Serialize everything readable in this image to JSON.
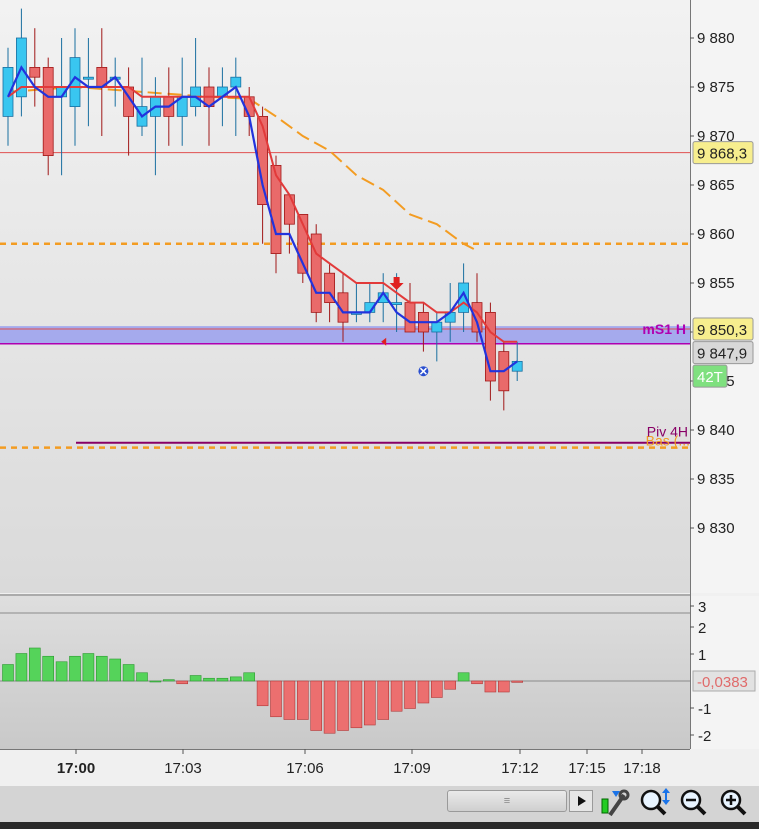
{
  "chart_data": {
    "type": "candlestick",
    "price_axis": {
      "ticks": [
        "9 880",
        "9 875",
        "9 870",
        "9 865",
        "9 860",
        "9 855",
        "9 850",
        "9 845",
        "9 840",
        "9 835",
        "9 830"
      ],
      "tick_values": [
        9880,
        9875,
        9870,
        9865,
        9860,
        9855,
        9850,
        9845,
        9840,
        9835,
        9830
      ],
      "range": [
        9820.8,
        9883
      ]
    },
    "time_axis": {
      "labels": [
        "17:00",
        "17:03",
        "17:06",
        "17:09",
        "17:12",
        "17:15",
        "17:18"
      ]
    },
    "price_tags": [
      {
        "label": "9 868,3",
        "value": 9868.3,
        "bg": "#f7ee8e",
        "color": "#222"
      },
      {
        "label": "9 850,3",
        "value": 9850.3,
        "bg": "#f7ee8e",
        "color": "#222"
      },
      {
        "label": "9 847,9",
        "value": 9847.9,
        "bg": "#d8d8d8",
        "color": "#222"
      },
      {
        "label": "42T",
        "value": 9845.5,
        "bg": "#7fe07f",
        "color": "#ffffff"
      }
    ],
    "levels": [
      {
        "name": "mS1 H",
        "value": 9849.6,
        "color": "#b000b0"
      },
      {
        "name": "Piv 4H",
        "value": 9838.7,
        "color": "#880066"
      },
      {
        "name": "Bas (...",
        "value": 9838.2,
        "color": "#f39c22"
      }
    ],
    "candles": [
      {
        "o": 9872,
        "c": 9877,
        "h": 9879,
        "l": 9869
      },
      {
        "o": 9874,
        "c": 9880,
        "h": 9883,
        "l": 9872
      },
      {
        "o": 9877,
        "c": 9876,
        "h": 9881,
        "l": 9873
      },
      {
        "o": 9877,
        "c": 9868,
        "h": 9878,
        "l": 9866
      },
      {
        "o": 9874,
        "c": 9875,
        "h": 9880,
        "l": 9866
      },
      {
        "o": 9873,
        "c": 9878,
        "h": 9881,
        "l": 9869
      },
      {
        "o": 9876,
        "c": 9876,
        "h": 9880,
        "l": 9871
      },
      {
        "o": 9877,
        "c": 9875,
        "h": 9881,
        "l": 9870
      },
      {
        "o": 9876,
        "c": 9876,
        "h": 9878,
        "l": 9873
      },
      {
        "o": 9875,
        "c": 9872,
        "h": 9877,
        "l": 9868
      },
      {
        "o": 9871,
        "c": 9873,
        "h": 9878,
        "l": 9870
      },
      {
        "o": 9872,
        "c": 9874,
        "h": 9876,
        "l": 9866
      },
      {
        "o": 9874,
        "c": 9872,
        "h": 9877,
        "l": 9869
      },
      {
        "o": 9872,
        "c": 9874,
        "h": 9878,
        "l": 9869
      },
      {
        "o": 9873,
        "c": 9875,
        "h": 9880,
        "l": 9872
      },
      {
        "o": 9875,
        "c": 9873,
        "h": 9877,
        "l": 9869
      },
      {
        "o": 9874,
        "c": 9875,
        "h": 9877,
        "l": 9871
      },
      {
        "o": 9875,
        "c": 9876,
        "h": 9878,
        "l": 9870
      },
      {
        "o": 9874,
        "c": 9872,
        "h": 9875,
        "l": 9870
      },
      {
        "o": 9872,
        "c": 9863,
        "h": 9873,
        "l": 9859
      },
      {
        "o": 9867,
        "c": 9858,
        "h": 9868,
        "l": 9856
      },
      {
        "o": 9864,
        "c": 9861,
        "h": 9864,
        "l": 9858
      },
      {
        "o": 9862,
        "c": 9856,
        "h": 9862,
        "l": 9855
      },
      {
        "o": 9860,
        "c": 9852,
        "h": 9861,
        "l": 9851
      },
      {
        "o": 9856,
        "c": 9853,
        "h": 9857,
        "l": 9851
      },
      {
        "o": 9854,
        "c": 9851,
        "h": 9856,
        "l": 9849
      },
      {
        "o": 9852,
        "c": 9852,
        "h": 9855,
        "l": 9851
      },
      {
        "o": 9852,
        "c": 9853,
        "h": 9855,
        "l": 9851
      },
      {
        "o": 9853,
        "c": 9854,
        "h": 9856,
        "l": 9851
      },
      {
        "o": 9853,
        "c": 9853,
        "h": 9856,
        "l": 9850
      },
      {
        "o": 9853,
        "c": 9850,
        "h": 9855,
        "l": 9850
      },
      {
        "o": 9852,
        "c": 9850,
        "h": 9853,
        "l": 9848
      },
      {
        "o": 9850,
        "c": 9851,
        "h": 9852,
        "l": 9847
      },
      {
        "o": 9851,
        "c": 9852,
        "h": 9855,
        "l": 9849
      },
      {
        "o": 9852,
        "c": 9855,
        "h": 9857,
        "l": 9850
      },
      {
        "o": 9853,
        "c": 9850,
        "h": 9856,
        "l": 9849
      },
      {
        "o": 9852,
        "c": 9845,
        "h": 9853,
        "l": 9843
      },
      {
        "o": 9848,
        "c": 9844,
        "h": 9849,
        "l": 9842
      },
      {
        "o": 9846,
        "c": 9847,
        "h": 9849,
        "l": 9845
      }
    ],
    "blue_line": [
      9874,
      9877,
      9875,
      9874,
      9874,
      9876,
      9875,
      9875,
      9876,
      9874,
      9872,
      9873,
      9873,
      9874,
      9874,
      9873,
      9874,
      9875,
      9872,
      9865,
      9860,
      9860,
      9857,
      9854,
      9854,
      9852,
      9852,
      9852,
      9854,
      9852,
      9851,
      9851,
      9851,
      9852,
      9854,
      9851,
      9846,
      9846,
      9847
    ],
    "red_line": [
      9874,
      9875,
      9875,
      9875,
      9875,
      9875,
      9875,
      9875,
      9875,
      9875,
      9874,
      9874,
      9874,
      9874,
      9874,
      9874,
      9874,
      9874,
      9874,
      9871,
      9866,
      9864,
      9861,
      9858,
      9857,
      9856,
      9855,
      9855,
      9855,
      9854,
      9853,
      9853,
      9852,
      9852,
      9853,
      9852,
      9850,
      9849,
      9849
    ],
    "orange_ma": [
      {
        "i": 0,
        "v": 9874.5
      },
      {
        "i": 5,
        "v": 9875
      },
      {
        "i": 10,
        "v": 9874.5
      },
      {
        "i": 15,
        "v": 9874
      },
      {
        "i": 18,
        "v": 9873.8
      },
      {
        "i": 20,
        "v": 9872
      },
      {
        "i": 22,
        "v": 9870
      },
      {
        "i": 24,
        "v": 9868.5
      },
      {
        "i": 26,
        "v": 9866
      },
      {
        "i": 28,
        "v": 9864.5
      },
      {
        "i": 30,
        "v": 9862
      },
      {
        "i": 32,
        "v": 9861
      },
      {
        "i": 34,
        "v": 9859
      },
      {
        "i": 35,
        "v": 9858.3
      }
    ],
    "markers": {
      "sell_arrow": {
        "i": 29,
        "v": 9855
      },
      "x_mark": {
        "i": 31,
        "v": 9846
      },
      "small_triangle": {
        "i": 28,
        "v": 9849
      }
    },
    "oscillator": {
      "ticks": [
        "3",
        "2",
        "1",
        "-1",
        "-2"
      ],
      "tick_values": [
        3,
        2,
        1,
        -1,
        -2
      ],
      "range": [
        -2.45,
        3.3
      ],
      "current_label": "-0,0383",
      "values": [
        0.6,
        1.0,
        1.2,
        0.9,
        0.7,
        0.9,
        1.0,
        0.9,
        0.8,
        0.6,
        0.3,
        0.0,
        0.05,
        -0.1,
        0.2,
        0.1,
        0.1,
        0.15,
        0.3,
        -0.9,
        -1.3,
        -1.4,
        -1.4,
        -1.8,
        -1.9,
        -1.8,
        -1.7,
        -1.6,
        -1.4,
        -1.1,
        -1.0,
        -0.8,
        -0.6,
        -0.3,
        0.3,
        -0.1,
        -0.4,
        -0.4,
        -0.05
      ]
    }
  },
  "toolbar": {
    "scroll_grip": "≡",
    "tools": [
      "wrench-icon",
      "zoom-auto-icon",
      "zoom-out-icon",
      "zoom-in-icon"
    ]
  }
}
